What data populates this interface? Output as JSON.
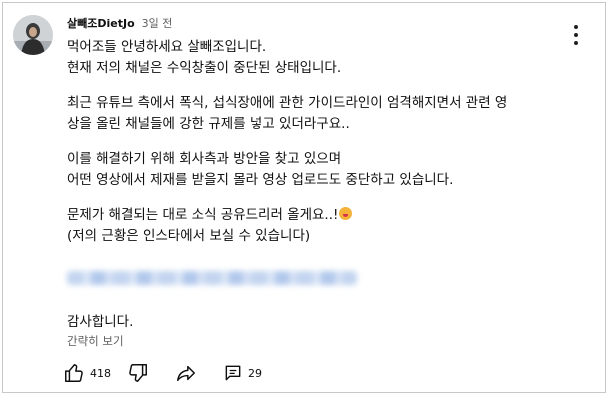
{
  "comment": {
    "author": "살빼조DietJo",
    "time": "3일 전",
    "lines": [
      "먹어조들 안녕하세요 살빼조입니다.",
      "현재 저의 채널은 수익창출이 중단된 상태입니다.",
      "최근 유튜브 측에서 폭식, 섭식장애에 관한 가이드라인이 엄격해지면서 관련 영",
      "상을 올린 채널들에 강한 규제를 넣고 있더라구요..",
      "이를 해결하기 위해 회사측과 방안을 찾고 있으며",
      "어떤 영상에서 제재를 받을지 몰라 영상 업로드도 중단하고 있습니다.",
      "문제가 해결되는 대로 소식 공유드리러 올게요..!",
      "(저의 근황은 인스타에서 보실 수 있습니다)"
    ],
    "thanks": "감사합니다.",
    "show_less": "간략히 보기"
  },
  "actions": {
    "like_count": "418",
    "reply_count": "29"
  },
  "icons": {
    "menu": "more-vert-icon",
    "like": "thumbs-up-icon",
    "dislike": "thumbs-down-icon",
    "share": "share-icon",
    "reply": "comment-icon"
  }
}
